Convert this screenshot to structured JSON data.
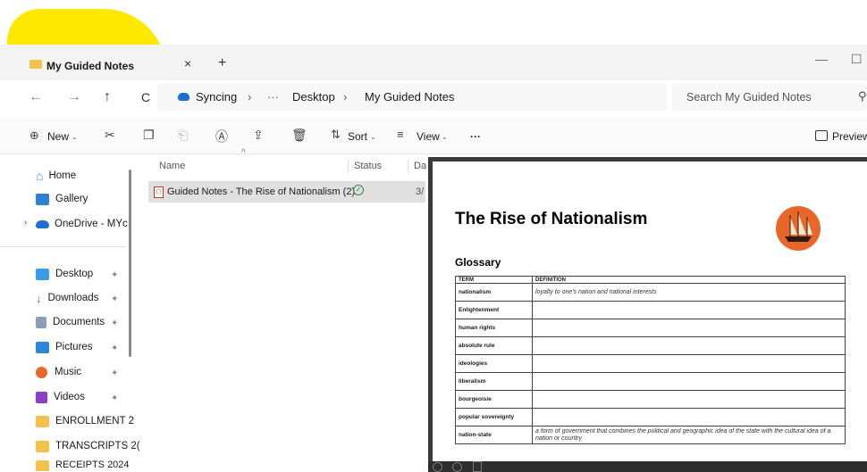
{
  "window": {
    "tab_title": "My Guided Notes",
    "close_tab": "×",
    "new_tab": "+",
    "minimize": "—",
    "maximize": "☐"
  },
  "address": {
    "back": "←",
    "forward": "→",
    "up": "↑",
    "refresh": "C",
    "sync_label": "Syncing",
    "sep": "›",
    "more": "···",
    "crumbs": [
      "Desktop",
      "My Guided Notes"
    ],
    "search_placeholder": "Search My Guided Notes"
  },
  "toolbar": {
    "new_label": "New",
    "sort_label": "Sort",
    "view_label": "View",
    "more_label": "···",
    "preview_label": "Preview"
  },
  "sidebar": {
    "items": [
      {
        "label": "Home",
        "color": "#3b8fd9"
      },
      {
        "label": "Gallery",
        "color": "#2f7fd3"
      },
      {
        "label": "OneDrive - MYc",
        "color": "#1f6fd0"
      },
      {
        "label": "Desktop",
        "color": "#3a9be8"
      },
      {
        "label": "Downloads",
        "color": "#2a8a4a"
      },
      {
        "label": "Documents",
        "color": "#8c9fb4"
      },
      {
        "label": "Pictures",
        "color": "#2d87d6"
      },
      {
        "label": "Music",
        "color": "#e56a2a"
      },
      {
        "label": "Videos",
        "color": "#8a3fc8"
      },
      {
        "label": "ENROLLMENT 2",
        "color": "#f2c14e"
      },
      {
        "label": "TRANSCRIPTS 2(",
        "color": "#f2c14e"
      },
      {
        "label": "RECEIPTS 2024",
        "color": "#f2c14e"
      }
    ]
  },
  "files": {
    "columns": {
      "name": "Name",
      "status": "Status",
      "date": "Da"
    },
    "rows": [
      {
        "name": "Guided Notes - The Rise of Nationalism (2)",
        "status_icon": "✓",
        "date": "3/"
      }
    ]
  },
  "preview": {
    "title": "The Rise of Nationalism",
    "glossary": "Glossary",
    "headers": {
      "term": "TERM",
      "definition": "DEFINITION"
    },
    "rows": [
      {
        "term": "nationalism",
        "definition": "loyalty to one's nation and national interests"
      },
      {
        "term": "Enlightenment",
        "definition": ""
      },
      {
        "term": "human rights",
        "definition": ""
      },
      {
        "term": "absolute rule",
        "definition": ""
      },
      {
        "term": "ideologies",
        "definition": ""
      },
      {
        "term": "liberalism",
        "definition": ""
      },
      {
        "term": "bourgeoisie",
        "definition": ""
      },
      {
        "term": "popular sovereignty",
        "definition": ""
      },
      {
        "term": "nation-state",
        "definition": "a form of government that combines the political and geographic idea of the state with the cultural idea of a nation or country"
      }
    ]
  },
  "colors": {
    "accent": "#0067c0",
    "highlight": "#ffe800"
  }
}
